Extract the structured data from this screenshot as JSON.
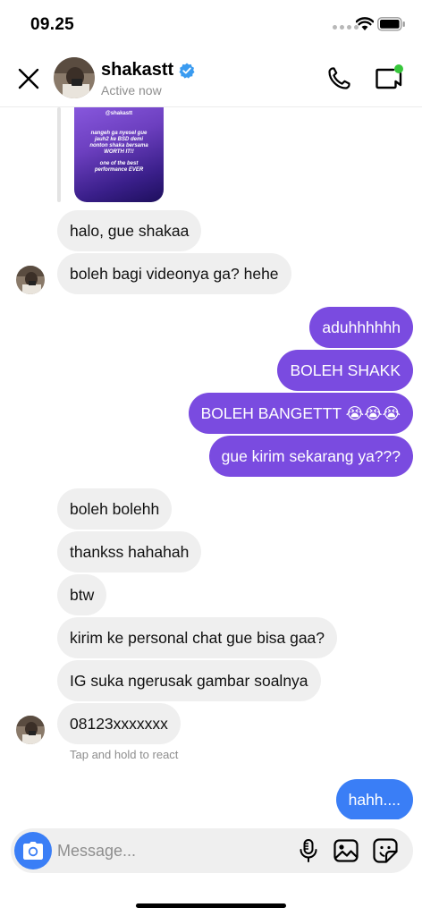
{
  "status_bar": {
    "time": "09.25"
  },
  "header": {
    "contact_name": "shakastt",
    "contact_status": "Active now"
  },
  "shared_media": {
    "handle": "@shakastt",
    "caption_lines": [
      "nangeh ga nyesel gue",
      "jauh2 ke BSD demi",
      "nonton shaka bersama",
      "WORTH IT!!"
    ],
    "caption_bottom": [
      "one of the best",
      "performance EVER"
    ]
  },
  "messages": [
    {
      "id": "m1",
      "side": "in",
      "text": "halo, gue shakaa"
    },
    {
      "id": "m2",
      "side": "in",
      "text": "boleh bagi videonya ga? hehe"
    },
    {
      "id": "m3",
      "side": "out",
      "text": "aduhhhhhh"
    },
    {
      "id": "m4",
      "side": "out",
      "text": "BOLEH SHAKK"
    },
    {
      "id": "m5",
      "side": "out",
      "text": "BOLEH BANGETTT 😭😭😭"
    },
    {
      "id": "m6",
      "side": "out",
      "text": "gue kirim sekarang ya???"
    },
    {
      "id": "m7",
      "side": "in",
      "text": "boleh bolehh"
    },
    {
      "id": "m8",
      "side": "in",
      "text": "thankss hahahah"
    },
    {
      "id": "m9",
      "side": "in",
      "text": "btw"
    },
    {
      "id": "m10",
      "side": "in",
      "text": "kirim ke personal chat gue bisa gaa?"
    },
    {
      "id": "m11",
      "side": "in",
      "text": "IG suka ngerusak gambar soalnya"
    },
    {
      "id": "m12",
      "side": "in",
      "text": "08123xxxxxxx"
    },
    {
      "id": "m13",
      "side": "out",
      "text": "hahh...."
    }
  ],
  "react_hint": "Tap and hold to react",
  "composer": {
    "placeholder": "Message..."
  },
  "colors": {
    "outgoing": "#7a4be0",
    "outgoing_last": "#3a7ef6",
    "incoming": "#efefef",
    "accent": "#3a7ef6",
    "active_dot": "#37c63b"
  },
  "icons": [
    "close-icon",
    "verified-icon",
    "call-icon",
    "video-icon",
    "camera-icon",
    "mic-icon",
    "gallery-icon",
    "sticker-icon"
  ]
}
